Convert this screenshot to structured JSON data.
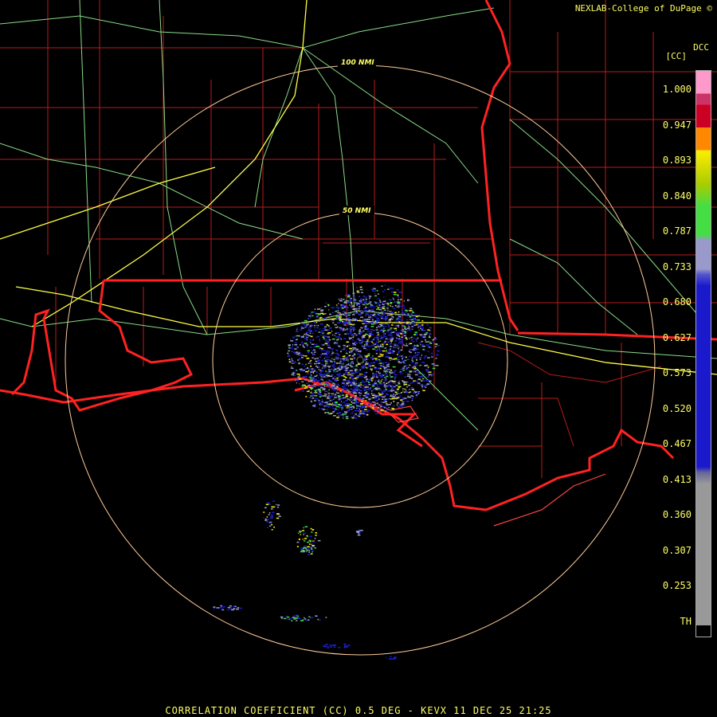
{
  "header": {
    "credit": "NEXLAB-College of DuPage ©",
    "site_short": "DCC",
    "unit": "[CC]"
  },
  "range_rings": [
    {
      "label": "100 NMI"
    },
    {
      "label": "50 NMI"
    }
  ],
  "color_scale": {
    "ticks": [
      "1.000",
      "0.947",
      "0.893",
      "0.840",
      "0.787",
      "0.733",
      "0.680",
      "0.627",
      "0.573",
      "0.520",
      "0.467",
      "0.413",
      "0.360",
      "0.307",
      "0.253",
      "TH"
    ],
    "colors": {
      "high": "#ff99cc",
      "red": "#cc0022",
      "orange": "#ff8800",
      "yellow": "#ffee00",
      "green": "#44dd44",
      "lavender": "#9999cc",
      "blue": "#1a1acc",
      "gray": "#999999",
      "threshold": "#000000"
    }
  },
  "colors": {
    "state_borders": "#ff2222",
    "county_borders": "#cc2222",
    "highways": "#99ee99",
    "interstates": "#ffff44",
    "range_rings": "#ffcc99",
    "text": "#ffff66"
  },
  "footer": {
    "caption": "CORRELATION COEFFICIENT (CC) 0.5 DEG - KEVX 11 DEC 25 21:25"
  }
}
